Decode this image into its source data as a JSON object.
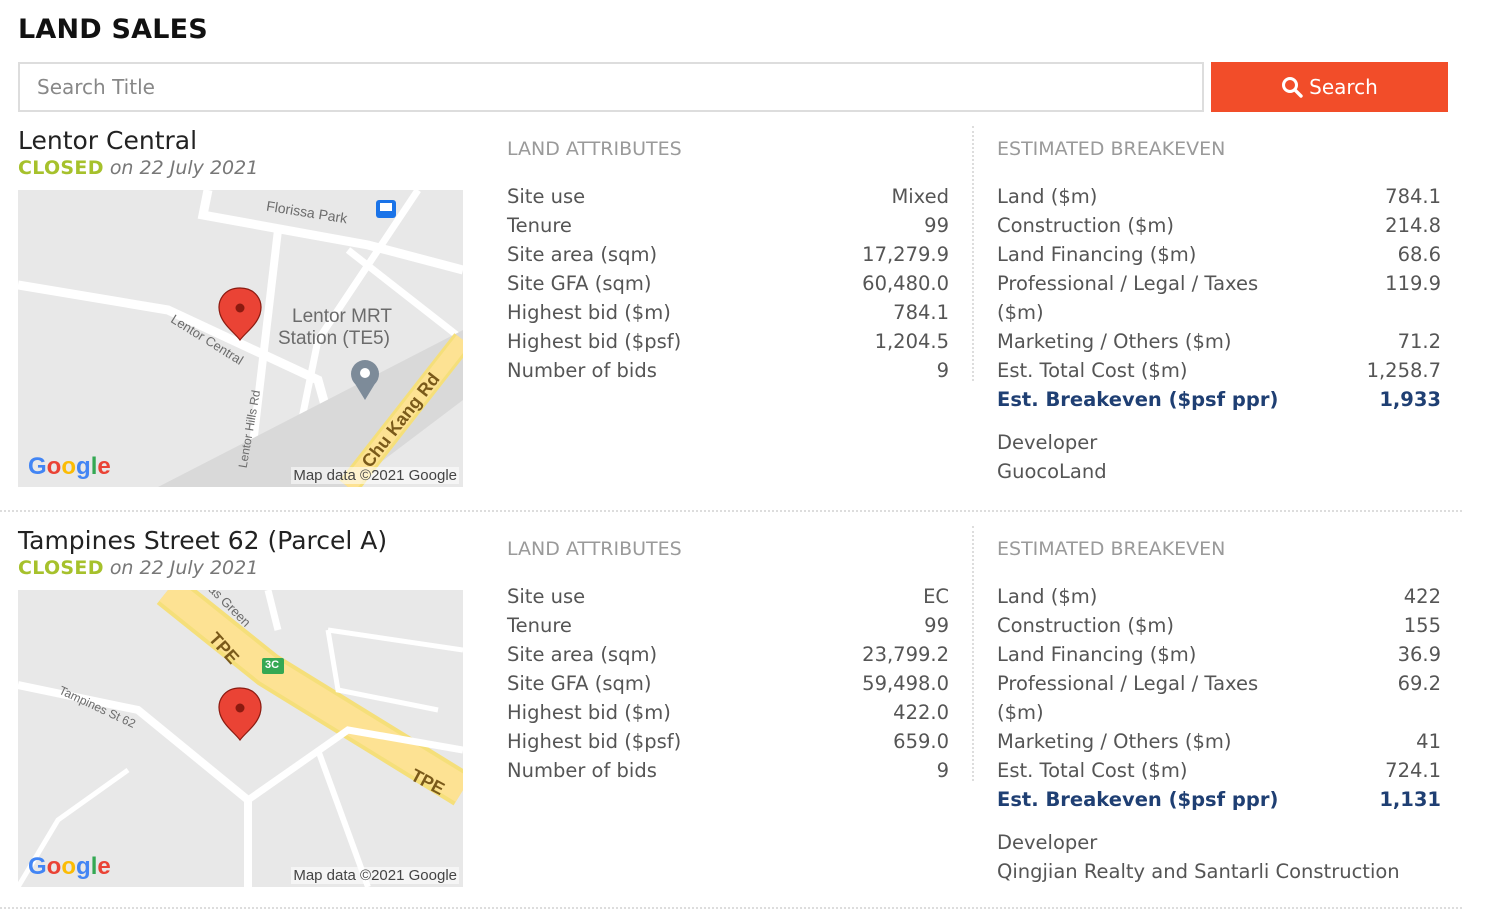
{
  "page": {
    "title": "LAND SALES"
  },
  "search": {
    "placeholder": "Search Title",
    "value": "",
    "button_label": "Search"
  },
  "colors": {
    "accent": "#f24d29",
    "closed": "#a6c12c",
    "highlight": "#1f3f73"
  },
  "listings": [
    {
      "title": "Lentor Central",
      "status": "CLOSED",
      "closed_on": "on 22 July 2021",
      "map": {
        "labels": [
          "Florissa Park",
          "Lentor Central",
          "Lentor MRT",
          "Station (TE5)",
          "Chu Kang Rd",
          "Lentor Hills Rd"
        ],
        "logo": "Google",
        "attribution": "Map data ©2021 Google"
      },
      "attributes_heading": "LAND ATTRIBUTES",
      "attributes": [
        {
          "label": "Site use",
          "value": "Mixed"
        },
        {
          "label": "Tenure",
          "value": "99"
        },
        {
          "label": "Site area (sqm)",
          "value": "17,279.9"
        },
        {
          "label": "Site GFA (sqm)",
          "value": "60,480.0"
        },
        {
          "label": "Highest bid ($m)",
          "value": "784.1"
        },
        {
          "label": "Highest bid ($psf)",
          "value": "1,204.5"
        },
        {
          "label": "Number of bids",
          "value": "9"
        }
      ],
      "breakeven_heading": "ESTIMATED BREAKEVEN",
      "breakeven": [
        {
          "label": "Land ($m)",
          "value": "784.1"
        },
        {
          "label": "Construction ($m)",
          "value": "214.8"
        },
        {
          "label": "Land Financing ($m)",
          "value": "68.6"
        },
        {
          "label": "Professional / Legal / Taxes ($m)",
          "value": "119.9"
        },
        {
          "label": "Marketing / Others ($m)",
          "value": "71.2"
        },
        {
          "label": "Est. Total Cost ($m)",
          "value": "1,258.7"
        },
        {
          "label": "Est. Breakeven ($psf ppr)",
          "value": "1,933"
        }
      ],
      "developer_label": "Developer",
      "developer": "GuocoLand"
    },
    {
      "title": "Tampines Street 62 (Parcel A)",
      "status": "CLOSED",
      "closed_on": "on 22 July 2021",
      "map": {
        "labels": [
          "lias Green",
          "TPE",
          "3C",
          "Tampines St 62",
          "TPE"
        ],
        "logo": "Google",
        "attribution": "Map data ©2021 Google"
      },
      "attributes_heading": "LAND ATTRIBUTES",
      "attributes": [
        {
          "label": "Site use",
          "value": "EC"
        },
        {
          "label": "Tenure",
          "value": "99"
        },
        {
          "label": "Site area (sqm)",
          "value": "23,799.2"
        },
        {
          "label": "Site GFA (sqm)",
          "value": "59,498.0"
        },
        {
          "label": "Highest bid ($m)",
          "value": "422.0"
        },
        {
          "label": "Highest bid ($psf)",
          "value": "659.0"
        },
        {
          "label": "Number of bids",
          "value": "9"
        }
      ],
      "breakeven_heading": "ESTIMATED BREAKEVEN",
      "breakeven": [
        {
          "label": "Land ($m)",
          "value": "422"
        },
        {
          "label": "Construction ($m)",
          "value": "155"
        },
        {
          "label": "Land Financing ($m)",
          "value": "36.9"
        },
        {
          "label": "Professional / Legal / Taxes ($m)",
          "value": "69.2"
        },
        {
          "label": "Marketing / Others ($m)",
          "value": "41"
        },
        {
          "label": "Est. Total Cost ($m)",
          "value": "724.1"
        },
        {
          "label": "Est. Breakeven ($psf ppr)",
          "value": "1,131"
        }
      ],
      "developer_label": "Developer",
      "developer": "Qingjian Realty and Santarli Construction"
    }
  ]
}
